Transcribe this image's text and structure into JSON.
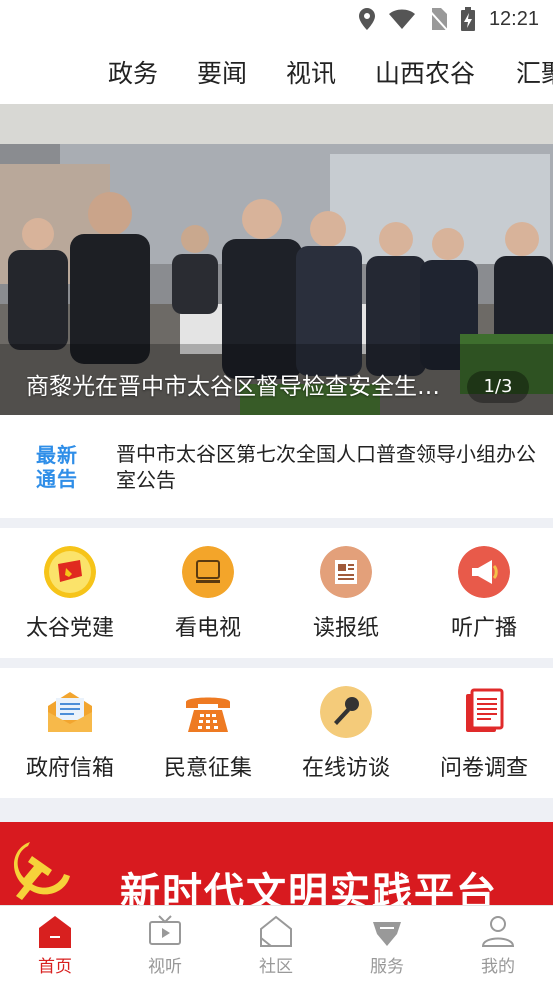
{
  "status_bar": {
    "time": "12:21"
  },
  "nav_tabs": [
    "政务",
    "要闻",
    "视讯",
    "山西农谷",
    "汇聚"
  ],
  "banner": {
    "caption": "商黎光在晋中市太谷区督导检查安全生产工作",
    "pager": "1/3"
  },
  "notice": {
    "logo_line1": "最新",
    "logo_line2": "通告",
    "text": "晋中市太谷区第七次全国人口普查领导小组办公室公告"
  },
  "services_row1": [
    {
      "label": "太谷党建",
      "icon": "party-emblem-icon"
    },
    {
      "label": "看电视",
      "icon": "tv-icon"
    },
    {
      "label": "读报纸",
      "icon": "newspaper-icon"
    },
    {
      "label": "听广播",
      "icon": "megaphone-icon"
    }
  ],
  "services_row2": [
    {
      "label": "政府信箱",
      "icon": "mailbox-icon"
    },
    {
      "label": "民意征集",
      "icon": "telephone-icon"
    },
    {
      "label": "在线访谈",
      "icon": "microphone-icon"
    },
    {
      "label": "问卷调查",
      "icon": "document-icon"
    }
  ],
  "promo": {
    "title": "新时代文明实践平台"
  },
  "tabbar": [
    {
      "label": "首页",
      "icon": "home-icon",
      "active": true
    },
    {
      "label": "视听",
      "icon": "video-icon",
      "active": false
    },
    {
      "label": "社区",
      "icon": "community-icon",
      "active": false
    },
    {
      "label": "服务",
      "icon": "service-icon",
      "active": false
    },
    {
      "label": "我的",
      "icon": "user-icon",
      "active": false
    }
  ],
  "colors": {
    "accent": "#d8201f",
    "notice_blue": "#2f8ee8",
    "divider": "#eef0f5"
  }
}
